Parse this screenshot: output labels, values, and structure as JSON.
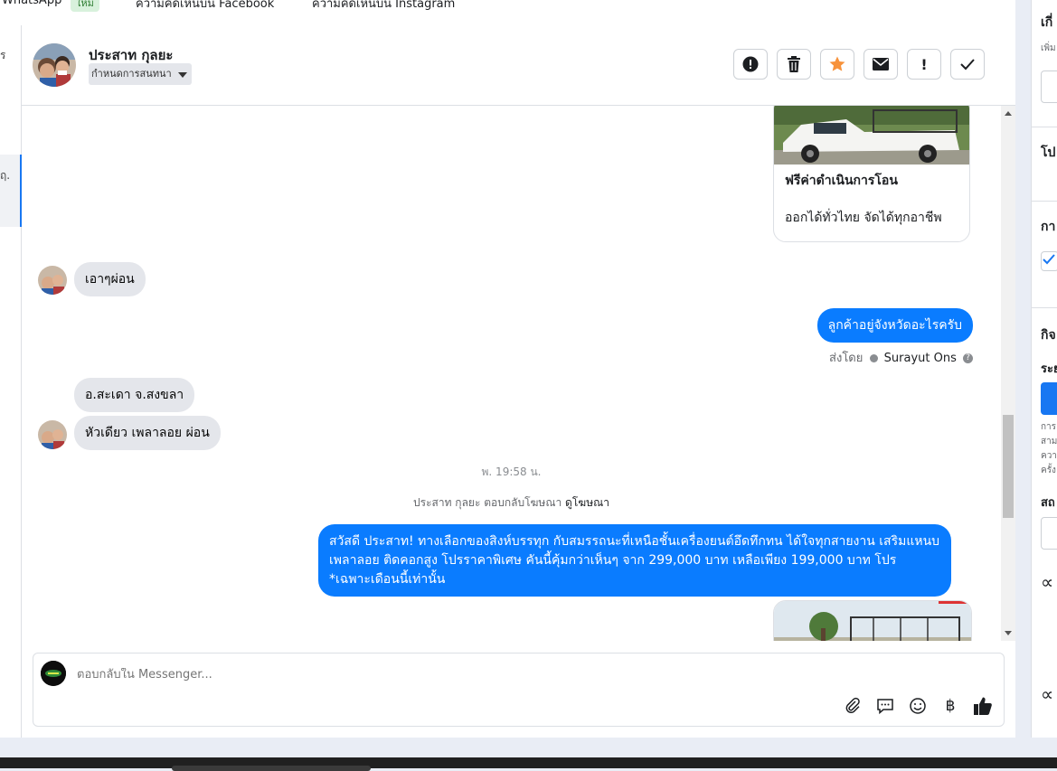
{
  "top_tabs": {
    "whatsapp": "WhatsApp",
    "new_badge": "ใหม่",
    "facebook_comments": "ความคิดเห็นบน Facebook",
    "instagram_comments": "ความคิดเห็นบน Instagram"
  },
  "left_fragments": {
    "a": "ร",
    "b": "ฤ."
  },
  "conversation": {
    "contact_name": "ประสาท กุลยะ",
    "assign_label": "กำหนดการสนทนา"
  },
  "header_actions": [
    {
      "icon": "alert-icon",
      "label": "!"
    },
    {
      "icon": "trash-icon",
      "label": ""
    },
    {
      "icon": "star-icon",
      "label": ""
    },
    {
      "icon": "envelope-icon",
      "label": ""
    },
    {
      "icon": "exclamation-icon",
      "label": "!"
    },
    {
      "icon": "check-icon",
      "label": ""
    }
  ],
  "messages": {
    "card_title": "ฟรีค่าดำเนินการโอน",
    "card_subtitle": "ออกได้ทั่วไทย จัดได้ทุกอาชีพ",
    "in1": "เอาๆผ่อน",
    "out1": "ลูกค้าอยู่จังหวัดอะไรครับ",
    "sent_by_label": "ส่งโดย",
    "sent_by_name": "Surayut Ons",
    "help_mark": "?",
    "in2": "อ.สะเดา  จ.สงขลา",
    "in3": "หัวเดียว เพลาลอย ผ่อน",
    "timestamp": "พ. 19:58 น.",
    "reply_text": "ประสาท กุลยะ ตอบกลับโฆษณา",
    "reply_link": "ดูโฆษณา",
    "ad_message": "สวัสดี ประสาท! ทางเลือกของสิงห์บรรทุก กับสมรรถนะที่เหนือชั้นเครื่องยนต์อึดทึกทน ได้ใจทุกสายงาน เสริมแหนบ เพลาลอย ติดคอกสูง โปรราคาพิเศษ คันนี้คุ้มกว่าเห็นๆ  จาก 299,000 บาท เหลือเพียง 199,000 บาท โปร *เฉพาะเดือนนี้เท่านั้น"
  },
  "composer": {
    "placeholder": "ตอบกลับใน Messenger...",
    "tools": [
      "attach-icon",
      "chat-bubble-icon",
      "emoji-icon",
      "baht-icon",
      "thumbs-up-icon"
    ],
    "baht_symbol": "฿"
  },
  "right_fragments": {
    "r1": "เกี่",
    "r1_sub": "เพิ่ม",
    "r2": "โป",
    "r3": "กา",
    "r4": "กิจ",
    "r5": "ระย",
    "r5_small": [
      "การ",
      "สาม",
      "ควา",
      "ครั้ง"
    ],
    "r6": "สถ",
    "r7": "∝",
    "r8": "∝"
  },
  "colors": {
    "accent": "#0a7cff",
    "star": "#f7923a",
    "incoming_bubble": "#e4e6eb",
    "page_bg": "#e9edf5"
  }
}
